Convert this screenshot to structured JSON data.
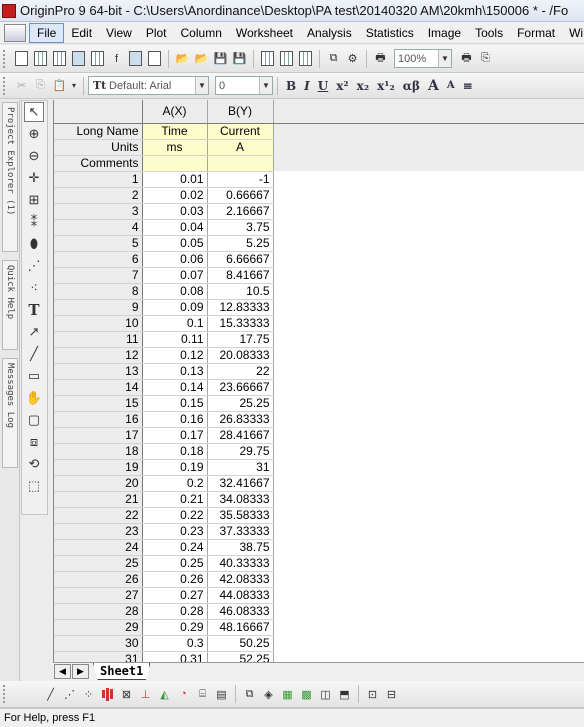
{
  "window": {
    "title": "OriginPro 9 64-bit - C:\\Users\\Anordinance\\Desktop\\PA test\\20140320 AM\\20kmh\\150006 * - /Fo"
  },
  "menu": [
    "File",
    "Edit",
    "View",
    "Plot",
    "Column",
    "Worksheet",
    "Analysis",
    "Statistics",
    "Image",
    "Tools",
    "Format",
    "Windo"
  ],
  "toolbar": {
    "zoom": "100%",
    "font": "Default: Arial",
    "font_size": "0"
  },
  "format_buttons": [
    "B",
    "I",
    "U",
    "x²",
    "x₂",
    "x¹₂",
    "αβ",
    "A",
    "A",
    "≡"
  ],
  "dock_tabs": [
    "Project Explorer (1)",
    "Quick Help",
    "Messages Log"
  ],
  "worksheet": {
    "columns": [
      {
        "header": "A(X)",
        "long_name": "Time",
        "units": "ms",
        "comments": ""
      },
      {
        "header": "B(Y)",
        "long_name": "Current",
        "units": "A",
        "comments": ""
      }
    ],
    "row_labels": {
      "long_name": "Long Name",
      "units": "Units",
      "comments": "Comments"
    },
    "rows": [
      [
        "1",
        "0.01",
        "-1"
      ],
      [
        "2",
        "0.02",
        "0.66667"
      ],
      [
        "3",
        "0.03",
        "2.16667"
      ],
      [
        "4",
        "0.04",
        "3.75"
      ],
      [
        "5",
        "0.05",
        "5.25"
      ],
      [
        "6",
        "0.06",
        "6.66667"
      ],
      [
        "7",
        "0.07",
        "8.41667"
      ],
      [
        "8",
        "0.08",
        "10.5"
      ],
      [
        "9",
        "0.09",
        "12.83333"
      ],
      [
        "10",
        "0.1",
        "15.33333"
      ],
      [
        "11",
        "0.11",
        "17.75"
      ],
      [
        "12",
        "0.12",
        "20.08333"
      ],
      [
        "13",
        "0.13",
        "22"
      ],
      [
        "14",
        "0.14",
        "23.66667"
      ],
      [
        "15",
        "0.15",
        "25.25"
      ],
      [
        "16",
        "0.16",
        "26.83333"
      ],
      [
        "17",
        "0.17",
        "28.41667"
      ],
      [
        "18",
        "0.18",
        "29.75"
      ],
      [
        "19",
        "0.19",
        "31"
      ],
      [
        "20",
        "0.2",
        "32.41667"
      ],
      [
        "21",
        "0.21",
        "34.08333"
      ],
      [
        "22",
        "0.22",
        "35.58333"
      ],
      [
        "23",
        "0.23",
        "37.33333"
      ],
      [
        "24",
        "0.24",
        "38.75"
      ],
      [
        "25",
        "0.25",
        "40.33333"
      ],
      [
        "26",
        "0.26",
        "42.08333"
      ],
      [
        "27",
        "0.27",
        "44.08333"
      ],
      [
        "28",
        "0.28",
        "46.08333"
      ],
      [
        "29",
        "0.29",
        "48.16667"
      ],
      [
        "30",
        "0.3",
        "50.25"
      ],
      [
        "31",
        "0.31",
        "52.25"
      ]
    ],
    "sheet_tab": "Sheet1"
  },
  "status": {
    "text": "For Help, press F1"
  }
}
